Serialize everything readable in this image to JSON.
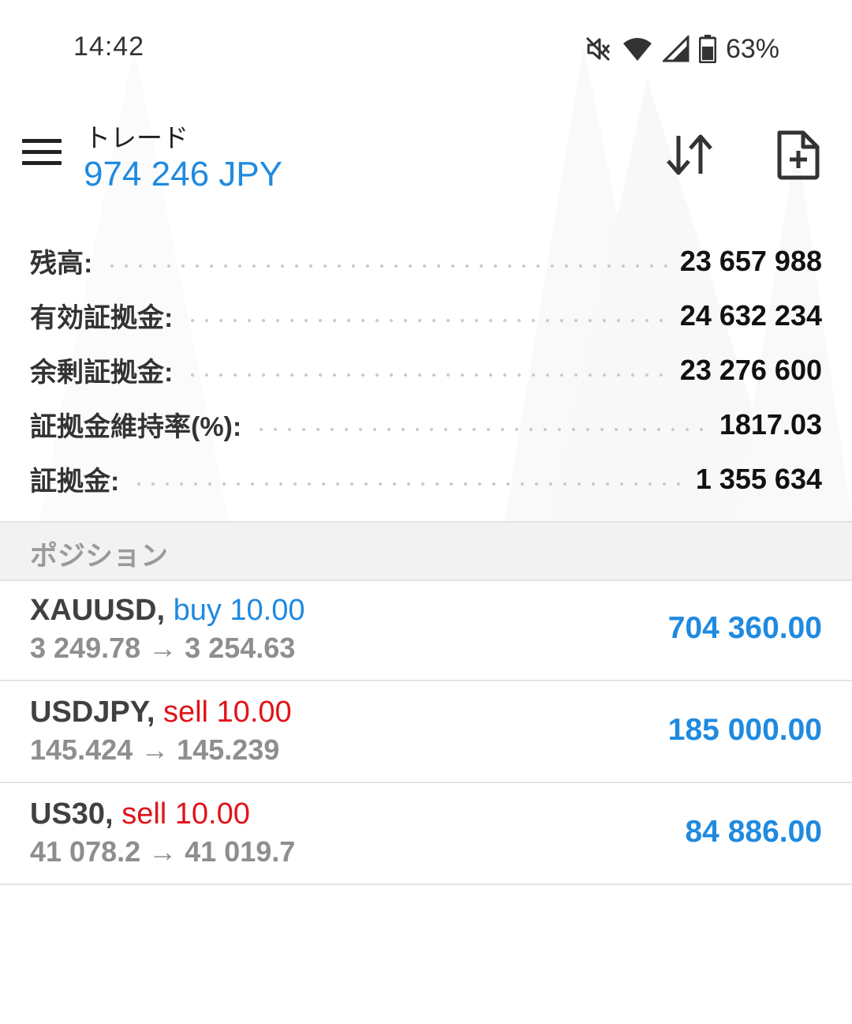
{
  "status_bar": {
    "time": "14:42",
    "icons": [
      "mute-icon",
      "wifi-icon",
      "signal-icon",
      "battery-icon"
    ],
    "battery_percent": "63%"
  },
  "toolbar": {
    "title": "トレード",
    "balance_display": "974 246 JPY",
    "icons": [
      "menu-icon",
      "sort-icon",
      "new-order-icon"
    ]
  },
  "account": [
    {
      "label": "残高:",
      "value": "23 657 988"
    },
    {
      "label": "有効証拠金:",
      "value": "24 632 234"
    },
    {
      "label": "余剰証拠金:",
      "value": "23 276 600"
    },
    {
      "label": "証拠金維持率(%):",
      "value": "1817.03"
    },
    {
      "label": "証拠金:",
      "value": "1 355 634"
    }
  ],
  "positions_header": "ポジション",
  "positions": [
    {
      "symbol": "XAUUSD,",
      "side": "buy",
      "volume_text": "buy 10.00",
      "prices": "3 249.78 → 3 254.63",
      "profit": "704 360.00"
    },
    {
      "symbol": "USDJPY,",
      "side": "sell",
      "volume_text": "sell 10.00",
      "prices": "145.424 → 145.239",
      "profit": "185 000.00"
    },
    {
      "symbol": "US30,",
      "side": "sell",
      "volume_text": "sell 10.00",
      "prices": "41 078.2 → 41 019.7",
      "profit": "84 886.00"
    }
  ],
  "colors": {
    "accent_blue": "#1f8ae0",
    "sell_red": "#e0131a",
    "secondary_gray": "#8e8e8e"
  }
}
